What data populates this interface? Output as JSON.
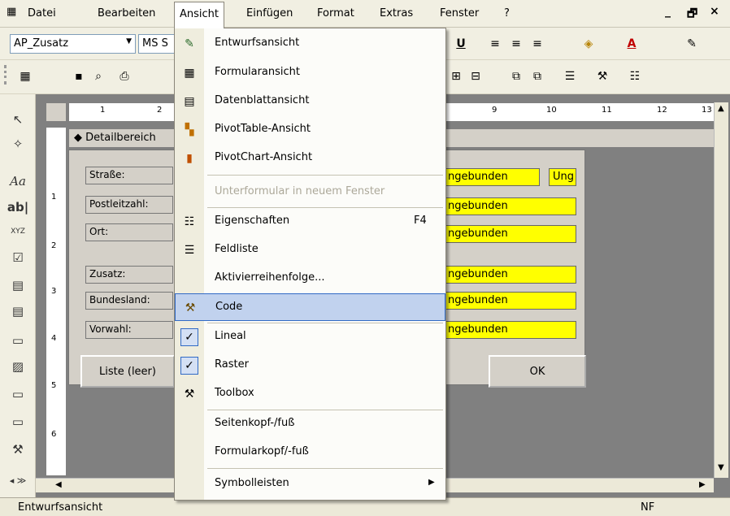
{
  "menubar": {
    "items": [
      "Datei",
      "Bearbeiten",
      "Ansicht",
      "Einfügen",
      "Format",
      "Extras",
      "Fenster",
      "?"
    ],
    "window_controls": [
      "_",
      "🗗",
      "×"
    ]
  },
  "formatting_toolbar": {
    "object_combo": "AP_Zusatz",
    "font_combo": "MS S"
  },
  "menu": {
    "items": [
      {
        "label": "Entwurfsansicht",
        "icon": "design-view-icon"
      },
      {
        "label": "Formularansicht",
        "icon": "form-view-icon"
      },
      {
        "label": "Datenblattansicht",
        "icon": "datasheet-view-icon"
      },
      {
        "label": "PivotTable-Ansicht",
        "icon": "pivottable-icon"
      },
      {
        "label": "PivotChart-Ansicht",
        "icon": "pivotchart-icon"
      },
      {
        "label": "Unterformular in neuem Fenster",
        "icon": "",
        "disabled": true
      },
      {
        "label": "Eigenschaften",
        "shortcut": "F4",
        "icon": "properties-icon"
      },
      {
        "label": "Feldliste",
        "icon": "field-list-icon"
      },
      {
        "label": "Aktivierreihenfolge...",
        "icon": ""
      },
      {
        "label": "Code",
        "icon": "code-icon",
        "highlighted": true
      },
      {
        "label": "Lineal",
        "icon": "checkmark-icon",
        "checked": true
      },
      {
        "label": "Raster",
        "icon": "checkmark-icon",
        "checked": true
      },
      {
        "label": "Toolbox",
        "icon": "toolbox-icon"
      },
      {
        "label": "Seitenkopf-/fuß",
        "icon": ""
      },
      {
        "label": "Formularkopf/-fuß",
        "icon": ""
      },
      {
        "label": "Symbolleisten",
        "icon": "",
        "submenu": true
      }
    ]
  },
  "design": {
    "section_header": "Detailbereich",
    "ruler_top_ticks": [
      "1",
      "2",
      "9",
      "10",
      "11",
      "12",
      "13"
    ],
    "ruler_left_ticks": [
      "1",
      "2",
      "3",
      "4",
      "5",
      "6"
    ],
    "labels": [
      "Straße:",
      "Postleitzahl:",
      "Ort:",
      "Zusatz:",
      "Bundesland:",
      "Vorwahl:"
    ],
    "fields": [
      "ngebunden",
      "ngebunden",
      "ngebunden",
      "ngebunden",
      "ngebunden",
      "ngebunden"
    ],
    "extra_field": "Ung",
    "button_liste": "Liste (leer)",
    "button_ok": "OK"
  },
  "statusbar": {
    "left": "Entwurfsansicht",
    "right": "NF"
  },
  "colors": {
    "unbound_field": "#ffff00",
    "menu_highlight": "#c1d2ee",
    "design_background": "#808080"
  }
}
